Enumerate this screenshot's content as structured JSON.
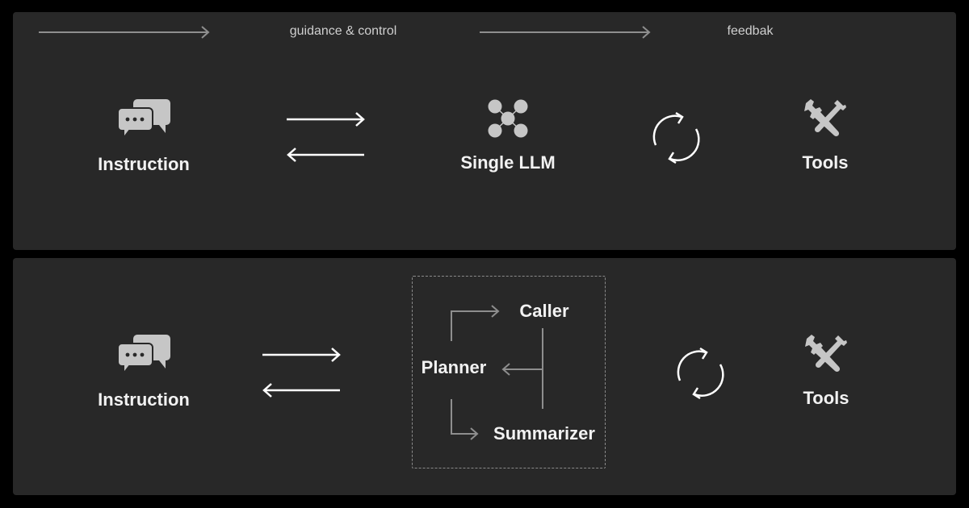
{
  "legend": {
    "guidance_label": "guidance & control",
    "feedback_label": "feedbak"
  },
  "top_panel": {
    "instruction_label": "Instruction",
    "llm_label": "Single LLM",
    "tools_label": "Tools"
  },
  "bottom_panel": {
    "instruction_label": "Instruction",
    "planner_label": "Planner",
    "caller_label": "Caller",
    "summarizer_label": "Summarizer",
    "tools_label": "Tools"
  },
  "colors": {
    "background": "#000000",
    "panel": "#282828",
    "icon_gray": "#c6c6c6",
    "arrow_white": "#ffffff",
    "arrow_gray": "#8e8e8e",
    "text": "#f2f2f2"
  }
}
